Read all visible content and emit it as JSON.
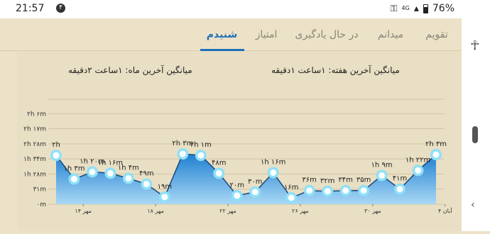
{
  "status": {
    "time": "21:57",
    "notif_count": "۴",
    "network": "4G",
    "battery": "76%"
  },
  "tabs": [
    {
      "label": "تقویم",
      "active": false
    },
    {
      "label": "میدانم",
      "active": false
    },
    {
      "label": "در حال یادگیری",
      "active": false
    },
    {
      "label": "امتیاز",
      "active": false
    },
    {
      "label": "شنیدم",
      "active": true
    }
  ],
  "stats": {
    "week_average": "میانگین آخرین هفته: ۱ساعت  ۱دقیقه",
    "month_average": "میانگین آخرین ماه: ۱ساعت  ۲دقیقه"
  },
  "colors": {
    "accent": "#1f6fb8",
    "area_top": "#1f7fd0",
    "area_bottom": "#a9d8f5",
    "point": "#8fe0f8"
  },
  "chart_data": {
    "type": "area",
    "title": "",
    "xlabel": "",
    "ylabel": "",
    "ylim": [
      0,
      146
    ],
    "y_ticks": [
      {
        "value": 0,
        "label": "۰m"
      },
      {
        "value": 21,
        "label": "۳۱m"
      },
      {
        "value": 42,
        "label": "۱h ۲۸m"
      },
      {
        "value": 63,
        "label": "۱h ۳۴m"
      },
      {
        "value": 84,
        "label": "۲h ۲۸m"
      },
      {
        "value": 105,
        "label": "۲h ۱۷m"
      },
      {
        "value": 126,
        "label": "۲h ۶m"
      },
      {
        "value": 146,
        "label": ""
      }
    ],
    "x_ticks": [
      {
        "index": 1.5,
        "label": "۱۴ مهر"
      },
      {
        "index": 5.5,
        "label": "۱۸ مهر"
      },
      {
        "index": 9.5,
        "label": "۲۲ مهر"
      },
      {
        "index": 13.5,
        "label": "۲۶ مهر"
      },
      {
        "index": 17.5,
        "label": "۳۰ مهر"
      },
      {
        "index": 21.5,
        "label": "۴ آبان"
      }
    ],
    "points": [
      {
        "label": "۲h",
        "value": 68
      },
      {
        "label": "۱h ۳m",
        "value": 35
      },
      {
        "label": "۱h ۲۰m",
        "value": 45
      },
      {
        "label": "۱h ۱۶m",
        "value": 43
      },
      {
        "label": "۱h ۴m",
        "value": 36
      },
      {
        "label": "۴۹m",
        "value": 28
      },
      {
        "label": "۱۹m",
        "value": 10
      },
      {
        "label": "۲h ۳m",
        "value": 70
      },
      {
        "label": "۲h ۱m",
        "value": 68
      },
      {
        "label": "۴۸m",
        "value": 43
      },
      {
        "label": "۲۰m",
        "value": 12
      },
      {
        "label": "۳۰m",
        "value": 17
      },
      {
        "label": "۱h ۱۶m",
        "value": 44
      },
      {
        "label": "۱۶m",
        "value": 9
      },
      {
        "label": "۳۶m",
        "value": 19
      },
      {
        "label": "۳۲m",
        "value": 18
      },
      {
        "label": "۳۴m",
        "value": 19
      },
      {
        "label": "۳۵m",
        "value": 19
      },
      {
        "label": "۱h ۹m",
        "value": 40
      },
      {
        "label": "۴۱m",
        "value": 21
      },
      {
        "label": "۱h ۲۲m",
        "value": 47
      },
      {
        "label": "۲h ۳m",
        "value": 69
      }
    ]
  }
}
